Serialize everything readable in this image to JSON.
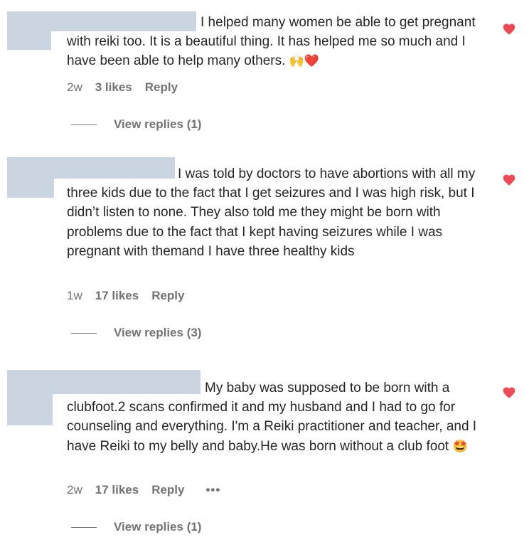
{
  "comments": [
    {
      "text": "I helped many women be able to get pregnant with reiki too. It is a beautiful thing. It has helped me so much and I have been able to help many others.",
      "emoji": "🙌❤️",
      "time": "2w",
      "likes": "3 likes",
      "reply": "Reply",
      "more": "",
      "view_replies": "View replies (1)"
    },
    {
      "text": "I was told by doctors to have abortions with all my three kids due to the fact that I get seizures and I was high risk, but I didn’t listen to none. They also told me they might be born with problems due to the fact that I kept having seizures while I was pregnant with themand I have three healthy kids",
      "emoji": "",
      "time": "1w",
      "likes": "17 likes",
      "reply": "Reply",
      "more": "",
      "view_replies": "View replies (3)"
    },
    {
      "text": "My baby was supposed to be born with a clubfoot.2 scans confirmed it and my husband and I had to go for counseling and everything. I'm a Reiki practitioner and teacher, and I have Reiki to my belly and baby.He was born without a club foot",
      "emoji": "🤩",
      "time": "2w",
      "likes": "17 likes",
      "reply": "Reply",
      "more": "•••",
      "view_replies": "View replies (1)"
    }
  ],
  "colors": {
    "heart": "#ed4956",
    "redaction": "#cbd5e1",
    "secondary_text": "#737373",
    "primary_text": "#262626"
  },
  "icons": {
    "like": "heart-icon"
  }
}
